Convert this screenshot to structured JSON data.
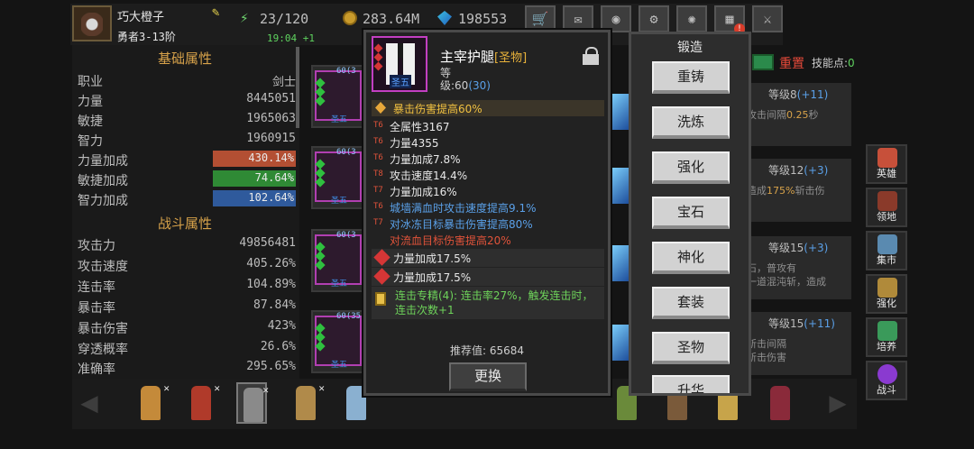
{
  "player": {
    "name": "巧大橙子",
    "rank": "勇者3-13阶",
    "energy": "23/120",
    "timer": "19:04 +1",
    "gold": "283.64M",
    "gems": "198553"
  },
  "toolbar": {
    "buttons": [
      "shop-icon",
      "mail-icon",
      "gamepad-icon",
      "gear-icon",
      "wheel-icon",
      "gift-icon",
      "battle-icon"
    ]
  },
  "stats": {
    "basic_title": "基础属性",
    "basic": [
      {
        "label": "职业",
        "value": "剑士"
      },
      {
        "label": "力量",
        "value": "8445051"
      },
      {
        "label": "敏捷",
        "value": "1965063"
      },
      {
        "label": "智力",
        "value": "1960915"
      }
    ],
    "bonuses": [
      {
        "label": "力量加成",
        "value": "430.14%",
        "color": "#b34f33"
      },
      {
        "label": "敏捷加成",
        "value": "74.64%",
        "color": "#2f8a35"
      },
      {
        "label": "智力加成",
        "value": "102.64%",
        "color": "#2f5a9c"
      }
    ],
    "combat_title": "战斗属性",
    "combat": [
      {
        "label": "攻击力",
        "value": "49856481"
      },
      {
        "label": "攻击速度",
        "value": "405.26%"
      },
      {
        "label": "连击率",
        "value": "104.89%"
      },
      {
        "label": "暴击率",
        "value": "87.84%"
      },
      {
        "label": "暴击伤害",
        "value": "423%"
      },
      {
        "label": "穿透概率",
        "value": "26.6%"
      },
      {
        "label": "准确率",
        "value": "295.65%"
      }
    ]
  },
  "equip_list": [
    {
      "level": "60(3",
      "tag": "圣五"
    },
    {
      "level": "60(3",
      "tag": "圣五"
    },
    {
      "level": "60(3",
      "tag": "圣五"
    },
    {
      "level": "60(35",
      "tag": "圣五"
    }
  ],
  "skills": {
    "reset": "重置",
    "points_label": "技能点:",
    "points": "0",
    "rows": [
      {
        "level": "等级8",
        "plus": "(+11)",
        "desc_a": "攻击间隔",
        "desc_b": "0.25",
        "desc_c": "秒"
      },
      {
        "level": "等级12",
        "plus": "(+3)",
        "desc_a": "造成",
        "desc_b": "175%",
        "desc_c": "斩击伤"
      },
      {
        "level": "等级15",
        "plus": "(+3)",
        "desc_a": "石，普攻有",
        "desc_b": "",
        "desc_c": "一道混沌斩，造成"
      },
      {
        "level": "等级15",
        "plus": "(+11)",
        "desc_a": "斩击间隔",
        "desc_b": "",
        "desc_c": "斩击伤害"
      }
    ]
  },
  "side_nav": [
    {
      "label": "英雄",
      "color": "#c7503a"
    },
    {
      "label": "领地",
      "color": "#8a3a2a"
    },
    {
      "label": "集市",
      "color": "#5a8ab0"
    },
    {
      "label": "强化",
      "color": "#b08a3a"
    },
    {
      "label": "培养",
      "color": "#3a9a5a"
    },
    {
      "label": "战斗",
      "color": "#8a3ad0"
    }
  ],
  "item": {
    "name": "主宰护腿",
    "quality": "[圣物]",
    "grade": "圣五",
    "type": "等",
    "level_label": "级:60",
    "level_bonus": "(30)",
    "special": "暴击伤害提高60%",
    "affixes": [
      {
        "tier": "T6",
        "text": "全属性3167",
        "color": "#e8e8e8"
      },
      {
        "tier": "T6",
        "text": "力量4355",
        "color": "#e8e8e8"
      },
      {
        "tier": "T6",
        "text": "力量加成7.8%",
        "color": "#e8e8e8"
      },
      {
        "tier": "T8",
        "text": "攻击速度14.4%",
        "color": "#e8e8e8"
      },
      {
        "tier": "T7",
        "text": "力量加成16%",
        "color": "#e8e8e8"
      },
      {
        "tier": "T6",
        "text": "城墙满血时攻击速度提高9.1%",
        "color": "#5aa0e8"
      },
      {
        "tier": "T7",
        "text": "对冰冻目标暴击伤害提高80%",
        "color": "#5aa0e8"
      },
      {
        "tier": "",
        "text": "对流血目标伤害提高20%",
        "color": "#e0533a"
      }
    ],
    "gems": [
      "力量加成17.5%",
      "力量加成17.5%"
    ],
    "set_text": "连击专精(4): 连击率27%，触发连击时，连击次数+1",
    "recommend": "推荐值: 65684",
    "replace": "更换"
  },
  "forge": {
    "title": "锻造",
    "buttons": [
      "重铸",
      "洗炼",
      "强化",
      "宝石",
      "神化",
      "套装",
      "圣物",
      "升华"
    ]
  }
}
